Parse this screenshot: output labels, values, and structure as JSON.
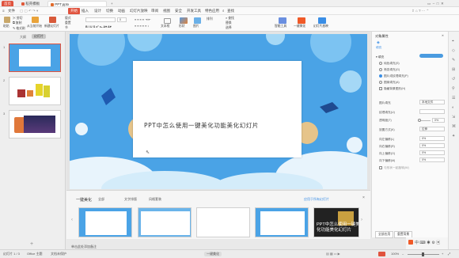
{
  "titlebar": {
    "tabs": [
      "首页",
      "稻壳模板",
      "PPT.pptx"
    ],
    "add_tab": "+"
  },
  "menubar": {
    "file": "文件",
    "active": "开始",
    "items": [
      "插入",
      "设计",
      "切换",
      "动画",
      "幻灯片放映",
      "审阅",
      "视图",
      "安全",
      "开发工具",
      "特色应用"
    ],
    "search": "查找"
  },
  "ribbon": {
    "paste": "粘贴",
    "cut": "剪切",
    "copy": "复制",
    "format_painter": "格式刷",
    "from_current": "从当前开始",
    "new_slide": "新建幻灯片",
    "layout": "版式",
    "reset": "重置",
    "section": "节",
    "font_size": "0",
    "shape": "形状",
    "picture": "图片",
    "textbox": "文本框",
    "arrange": "排列",
    "find": "查找",
    "replace": "替换",
    "select": "选择",
    "smart": "智能工具",
    "beautify": "一键美化",
    "slideshow": "幻灯片放映"
  },
  "leftpanel": {
    "tab_outline": "大纲",
    "tab_slides": "幻灯片",
    "slide_numbers": [
      "1",
      "2",
      "3"
    ],
    "add": "+"
  },
  "slide": {
    "title": "PPT中怎么使用一键美化功能美化幻灯片"
  },
  "beauty": {
    "title": "一键美化",
    "filters": [
      "全部",
      "文字排版",
      "风格套装"
    ],
    "thumb_title": "PPT中怎么使用一键美化功能美化幻灯片",
    "close": "×",
    "apply_all": "应用于所有幻灯片"
  },
  "rightpanel": {
    "title": "对象属性",
    "tab_fill": "填充",
    "section_fill": "填充",
    "options": [
      "纯色填充(S)",
      "渐变填充(G)",
      "图片或纹理填充(P)",
      "图案填充(A)",
      "隐藏背景图形(H)"
    ],
    "image_fill": "图片填充",
    "image_fill_value": "本地文件",
    "texture": "纹理填充(U)",
    "transparency": "透明度(T)",
    "transparency_value": "0%",
    "offset_label": "放置方式(K)",
    "offset_value": "拉伸",
    "offsets": [
      {
        "label": "向左偏移(L)",
        "value": "0%"
      },
      {
        "label": "向右偏移(R)",
        "value": "0%"
      },
      {
        "label": "向上偏移(O)",
        "value": "0%"
      },
      {
        "label": "向下偏移(M)",
        "value": "0%"
      }
    ],
    "tile_check": "与形状一起旋转(W)",
    "apply_all": "全部应用",
    "reset_bg": "重置背景"
  },
  "statusbar": {
    "slide_info": "幻灯片 1 / 3",
    "theme": "Office 主题",
    "note": "单击此处添加备注",
    "protect": "文档未保护",
    "zoom": "100%",
    "mode": "一键美化"
  },
  "colors": {
    "accent": "#e0533e",
    "slide_bg": "#4aa3e6",
    "selection": "#3a8ee6",
    "beautify_btn": "#f05a28"
  }
}
